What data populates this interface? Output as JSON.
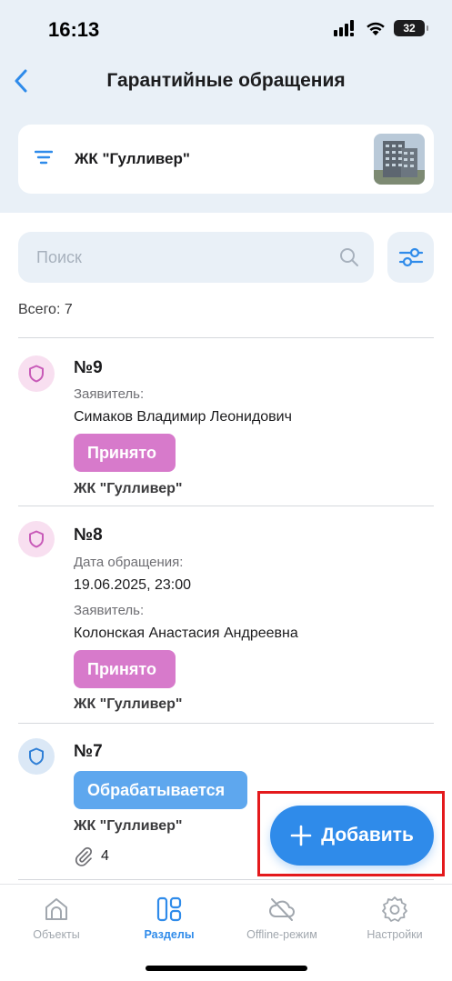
{
  "status_bar": {
    "time": "16:13",
    "battery": "32"
  },
  "header": {
    "title": "Гарантийные обращения"
  },
  "object_selector": {
    "name": "ЖК \"Гулливер\""
  },
  "search": {
    "placeholder": "Поиск"
  },
  "total": "Всего: 7",
  "requests": [
    {
      "number": "№9",
      "applicant_label": "Заявитель:",
      "applicant": "Симаков Владимир Леонидович",
      "status": "Принято",
      "object": "ЖК \"Гулливер\""
    },
    {
      "number": "№8",
      "date_label": "Дата обращения:",
      "date": "19.06.2025, 23:00",
      "applicant_label": "Заявитель:",
      "applicant": "Колонская Анастасия Андреевна",
      "status": "Принято",
      "object": "ЖК \"Гулливер\""
    },
    {
      "number": "№7",
      "status": "Обрабатывается",
      "object": "ЖК \"Гулливер\"",
      "attachments": "4"
    }
  ],
  "add_button": {
    "label": "Добавить"
  },
  "tabs": [
    {
      "label": "Объекты",
      "icon": "home-icon"
    },
    {
      "label": "Разделы",
      "icon": "grid-icon",
      "active": true
    },
    {
      "label": "Offline-режим",
      "icon": "cloud-off-icon"
    },
    {
      "label": "Настройки",
      "icon": "gear-icon"
    }
  ],
  "colors": {
    "accent": "#2f8bea",
    "status_accepted": "#d77acb",
    "status_processing": "#5ea7ee",
    "highlight": "#e4191c"
  }
}
